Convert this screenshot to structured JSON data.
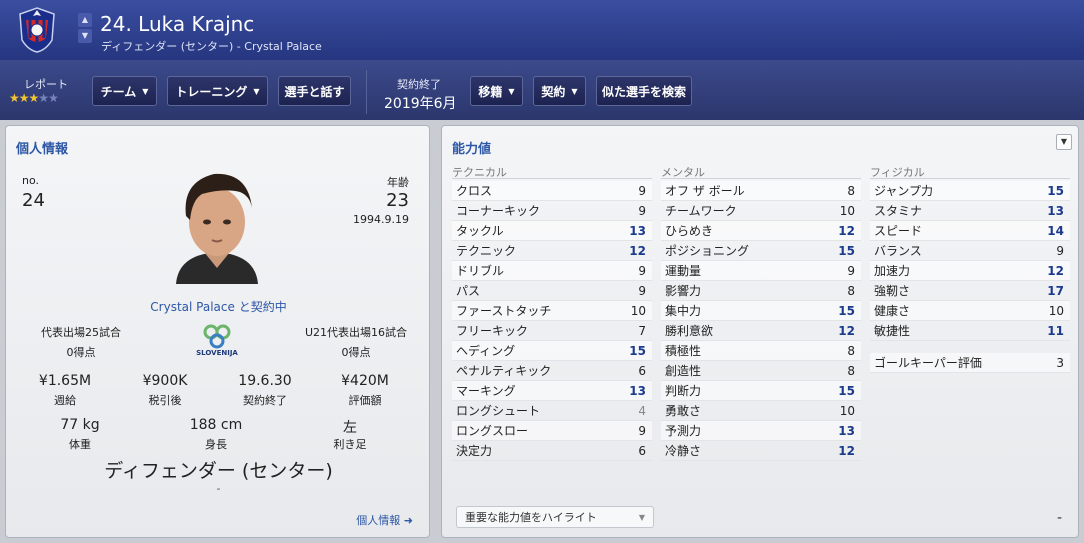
{
  "player": {
    "title": "24. Luka Krajnc",
    "subtitle": "ディフェンダー (センター) - Crystal Palace"
  },
  "toolbar": {
    "report_label": "レポート",
    "stars_filled": 3,
    "stars_total": 5,
    "team_btn": "チーム",
    "training_btn": "トレーニング",
    "talk_btn": "選手と話す",
    "contract_end_label": "契約終了",
    "contract_end_value": "2019年6月",
    "transfer_btn": "移籍",
    "contract_btn": "契約",
    "similar_btn": "似た選手を検索"
  },
  "personal": {
    "title": "個人情報",
    "no_label": "no.",
    "no_value": "24",
    "age_label": "年齢",
    "age_value": "23",
    "dob": "1994.9.19",
    "club_status": "Crystal Palace と契約中",
    "caps_label": "代表出場25試合",
    "caps_goals": "0得点",
    "u21_label": "U21代表出場16試合",
    "u21_goals": "0得点",
    "country": "SLOVENIJA",
    "wage_value": "¥1.65M",
    "wage_label": "週給",
    "net_value": "¥900K",
    "net_label": "税引後",
    "contract_value": "19.6.30",
    "contract_label": "契約終了",
    "valuation_value": "¥420M",
    "valuation_label": "評価額",
    "weight_value": "77 kg",
    "weight_label": "体重",
    "height_value": "188 cm",
    "height_label": "身長",
    "foot_value": "左",
    "foot_label": "利き足",
    "position": "ディフェンダー (センター)",
    "dash": "-",
    "more_link": "個人情報 ➜"
  },
  "attributes": {
    "title": "能力値",
    "technical": {
      "heading": "テクニカル",
      "rows": [
        {
          "name": "クロス",
          "value": "9",
          "style": ""
        },
        {
          "name": "コーナーキック",
          "value": "9",
          "style": ""
        },
        {
          "name": "タックル",
          "value": "13",
          "style": "hi"
        },
        {
          "name": "テクニック",
          "value": "12",
          "style": "hi"
        },
        {
          "name": "ドリブル",
          "value": "9",
          "style": ""
        },
        {
          "name": "パス",
          "value": "9",
          "style": ""
        },
        {
          "name": "ファーストタッチ",
          "value": "10",
          "style": ""
        },
        {
          "name": "フリーキック",
          "value": "7",
          "style": ""
        },
        {
          "name": "ヘディング",
          "value": "15",
          "style": "hi"
        },
        {
          "name": "ペナルティキック",
          "value": "6",
          "style": ""
        },
        {
          "name": "マーキング",
          "value": "13",
          "style": "hi"
        },
        {
          "name": "ロングシュート",
          "value": "4",
          "style": "lo"
        },
        {
          "name": "ロングスロー",
          "value": "9",
          "style": ""
        },
        {
          "name": "決定力",
          "value": "6",
          "style": ""
        }
      ]
    },
    "mental": {
      "heading": "メンタル",
      "rows": [
        {
          "name": "オフ ザ ボール",
          "value": "8",
          "style": ""
        },
        {
          "name": "チームワーク",
          "value": "10",
          "style": ""
        },
        {
          "name": "ひらめき",
          "value": "12",
          "style": "hi"
        },
        {
          "name": "ポジショニング",
          "value": "15",
          "style": "hi"
        },
        {
          "name": "運動量",
          "value": "9",
          "style": ""
        },
        {
          "name": "影響力",
          "value": "8",
          "style": ""
        },
        {
          "name": "集中力",
          "value": "15",
          "style": "hi"
        },
        {
          "name": "勝利意欲",
          "value": "12",
          "style": "hi"
        },
        {
          "name": "積極性",
          "value": "8",
          "style": ""
        },
        {
          "name": "創造性",
          "value": "8",
          "style": ""
        },
        {
          "name": "判断力",
          "value": "15",
          "style": "hi"
        },
        {
          "name": "勇敢さ",
          "value": "10",
          "style": ""
        },
        {
          "name": "予測力",
          "value": "13",
          "style": "hi"
        },
        {
          "name": "冷静さ",
          "value": "12",
          "style": "hi"
        }
      ]
    },
    "physical": {
      "heading": "フィジカル",
      "rows": [
        {
          "name": "ジャンプ力",
          "value": "15",
          "style": "hi"
        },
        {
          "name": "スタミナ",
          "value": "13",
          "style": "hi"
        },
        {
          "name": "スピード",
          "value": "14",
          "style": "hi"
        },
        {
          "name": "バランス",
          "value": "9",
          "style": ""
        },
        {
          "name": "加速力",
          "value": "12",
          "style": "hi"
        },
        {
          "name": "強靭さ",
          "value": "17",
          "style": "hi"
        },
        {
          "name": "健康さ",
          "value": "10",
          "style": ""
        },
        {
          "name": "敏捷性",
          "value": "11",
          "style": "hi"
        }
      ],
      "gk_label": "ゴールキーパー評価",
      "gk_value": "3"
    },
    "highlight_select": "重要な能力値をハイライト",
    "bottom_dash": "-"
  },
  "colors": {
    "header_blue": "#2d3f93",
    "link_blue": "#2d57a6",
    "star_gold": "#f3c431",
    "highlight_value": "#1b3a8c"
  }
}
